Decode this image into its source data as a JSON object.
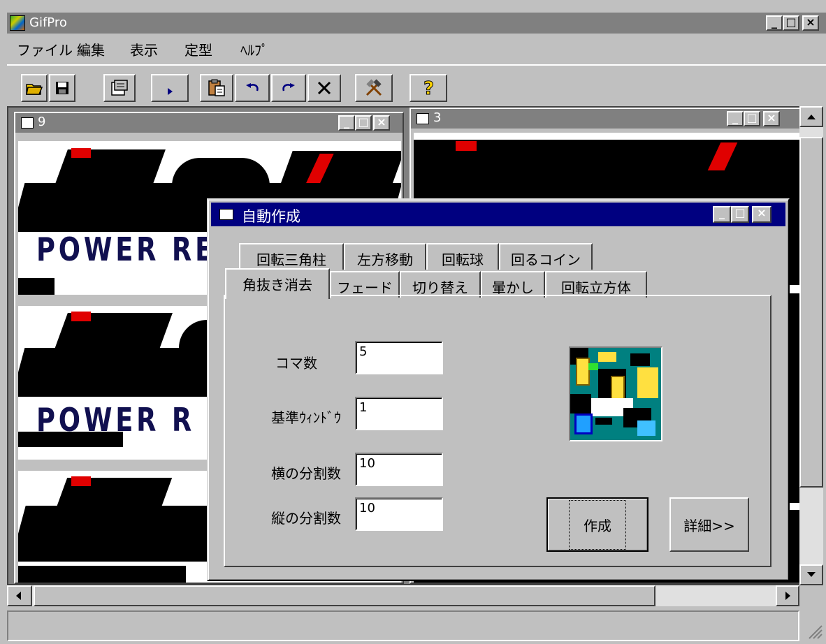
{
  "app": {
    "title": "GifPro",
    "caption_buttons": [
      "_",
      "□",
      "×"
    ]
  },
  "menu": [
    "ファイル",
    "編集",
    "表示",
    "定型",
    "ﾍﾙﾌﾟ"
  ],
  "toolbar": {
    "open_icon": "folder-open-icon",
    "save_icon": "save-disk-icon",
    "properties_icon": "properties-icon",
    "play_icon": "play-icon",
    "paste_icon": "paste-icon",
    "undo_icon": "undo-icon",
    "redo_icon": "redo-icon",
    "delete_icon": "delete-x-icon",
    "tools_icon": "hammer-tools-icon",
    "help_icon": "help-question-icon"
  },
  "child_windows": [
    {
      "title": "9",
      "banner_text": "POWER RE"
    },
    {
      "title": "3"
    }
  ],
  "frames_banner": "POWER R",
  "dialog": {
    "title": "自動作成",
    "tabs_row1": [
      "回転三角柱",
      "左方移動",
      "回転球",
      "回るコイン"
    ],
    "tabs_row2": [
      "角抜き消去",
      "フェード",
      "切り替え",
      "暈かし",
      "回転立方体"
    ],
    "active_tab": "角抜き消去",
    "fields": [
      {
        "label": "コマ数",
        "value": "5"
      },
      {
        "label": "基準ｳｨﾝﾄﾞｳ",
        "value": "1"
      },
      {
        "label": "横の分割数",
        "value": "10"
      },
      {
        "label": "縦の分割数",
        "value": "10"
      }
    ],
    "create_button": "作成",
    "detail_button": "詳細>>"
  },
  "colors": {
    "active_titlebar": "#000080",
    "inactive_titlebar": "#808080",
    "face": "#c0c0c0",
    "logo_red": "#e00000",
    "logo_navy": "#111050",
    "preview_teal": "#008080"
  }
}
